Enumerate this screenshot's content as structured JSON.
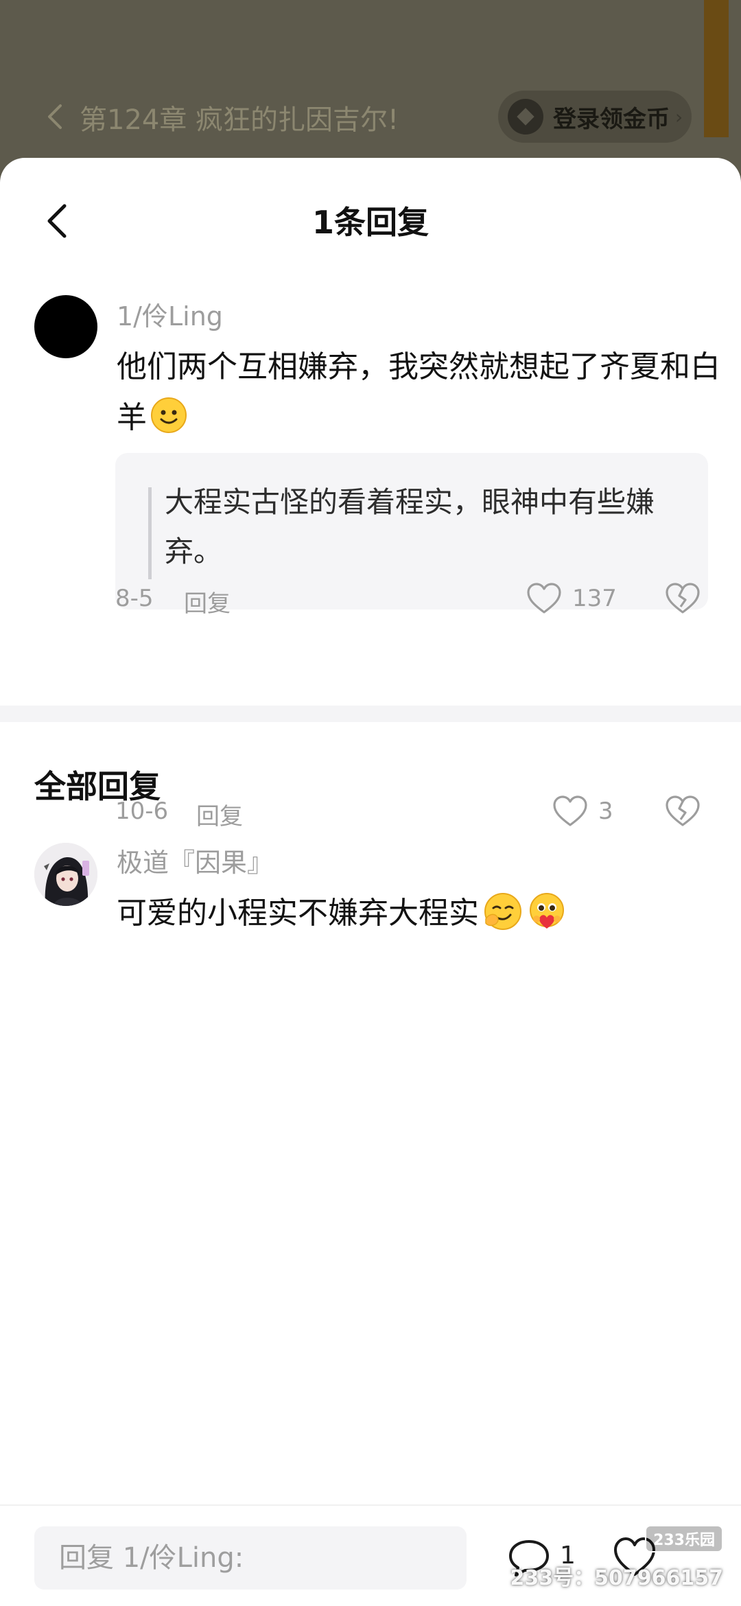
{
  "reader": {
    "chapter_title": "第124章 疯狂的扎因吉尔!",
    "login_label": "登录领金币",
    "login_chevron": "›"
  },
  "sheet": {
    "title": "1条回复"
  },
  "main_comment": {
    "username": "1/伶Ling",
    "text": "他们两个互相嫌弃，我突然就想起了齐夏和白羊",
    "quote": "大程实古怪的看着程实，眼神中有些嫌弃。",
    "date": "8-5",
    "reply_label": "回复",
    "like_count": "137"
  },
  "all_replies": {
    "title": "全部回复",
    "items": [
      {
        "username": "极道『因果』",
        "text": "可爱的小程实不嫌弃大程实",
        "date": "10-6",
        "reply_label": "回复",
        "like_count": "3"
      }
    ]
  },
  "bottom_bar": {
    "input_placeholder": "回复 1/伶Ling:",
    "comment_count": "1"
  },
  "watermark": {
    "logo": "233乐园",
    "id_text": "233号：507966157"
  },
  "colors": {
    "overlay_bg": "#5d5a4c",
    "sheet_bg": "#ffffff",
    "muted_text": "#9d9d9d",
    "bookmark": "#6a4b14"
  }
}
